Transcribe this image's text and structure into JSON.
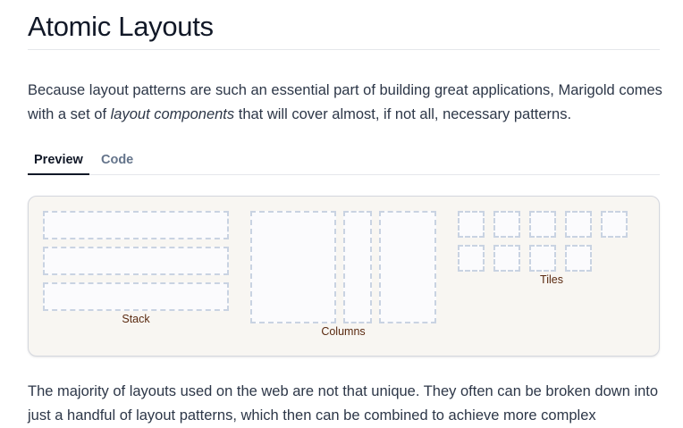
{
  "page": {
    "title": "Atomic Layouts",
    "intro_before": "Because layout patterns are such an essential part of building great applications, Marigold comes with a set of ",
    "intro_emphasis": "layout components",
    "intro_after": " that will cover almost, if not all, necessary patterns.",
    "outro": "The majority of layouts used on the web are not that unique. They often can be broken down into just a handful of layout patterns, which then can be combined to achieve more complex"
  },
  "tabs": [
    {
      "label": "Preview",
      "selected": true
    },
    {
      "label": "Code",
      "selected": false
    }
  ],
  "preview": {
    "stack_label": "Stack",
    "columns_label": "Columns",
    "tiles_label": "Tiles"
  }
}
